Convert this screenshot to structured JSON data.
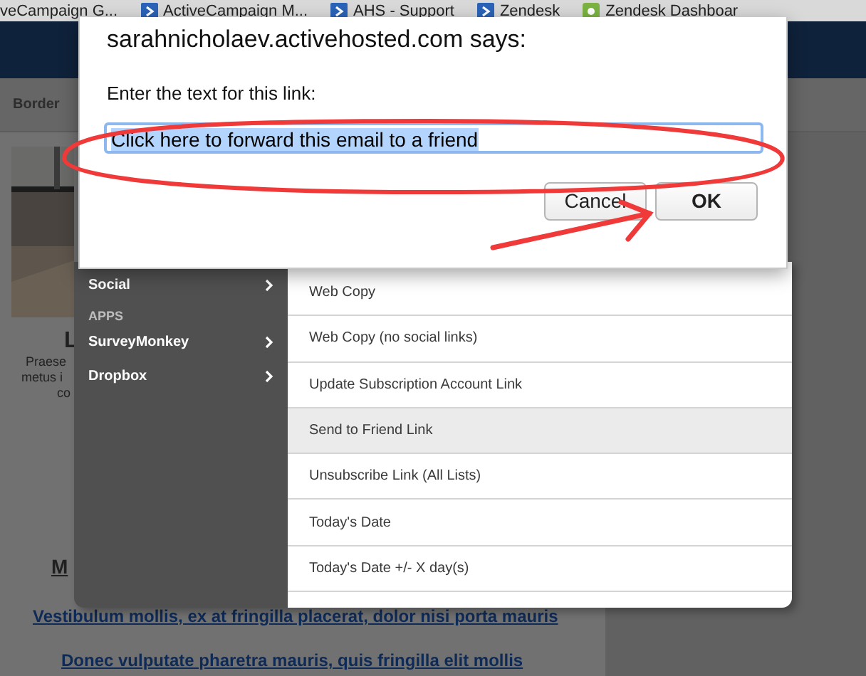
{
  "bookmarks": [
    {
      "label": "veCampaign G..."
    },
    {
      "label": "ActiveCampaign M..."
    },
    {
      "label": "AHS - Support"
    },
    {
      "label": "Zendesk"
    },
    {
      "label": "Zendesk Dashboar"
    }
  ],
  "page": {
    "toolbar_label": "Border",
    "photo": {
      "kind": "picture"
    },
    "heading": "L",
    "body_lines": [
      "Praese",
      "metus i",
      "co"
    ],
    "subheading": "M",
    "links": [
      "Vestibulum mollis, ex at fringilla placerat, dolor nisi porta mauris",
      "Donec vulputate pharetra mauris, quis fringilla elit mollis"
    ]
  },
  "insert_menu": {
    "categories": [
      {
        "kind": "item",
        "label": "Social"
      },
      {
        "kind": "heading",
        "label": "APPS"
      },
      {
        "kind": "item",
        "label": "SurveyMonkey"
      },
      {
        "kind": "item",
        "label": "Dropbox"
      }
    ],
    "options": [
      {
        "label": "Web Copy",
        "selected": false
      },
      {
        "label": "Web Copy (no social links)",
        "selected": false
      },
      {
        "label": "Update Subscription Account Link",
        "selected": false
      },
      {
        "label": "Send to Friend Link",
        "selected": true
      },
      {
        "label": "Unsubscribe Link (All Lists)",
        "selected": false
      },
      {
        "label": "Today's Date",
        "selected": false
      },
      {
        "label": "Today's Date +/- X day(s)",
        "selected": false
      }
    ]
  },
  "dialog": {
    "title": "sarahnicholaev.activehosted.com says:",
    "prompt": "Enter the text for this link:",
    "input_value": "Click here to forward this email to a friend",
    "buttons": [
      {
        "label": "Cancel",
        "default": false
      },
      {
        "label": "OK",
        "default": true
      }
    ]
  }
}
